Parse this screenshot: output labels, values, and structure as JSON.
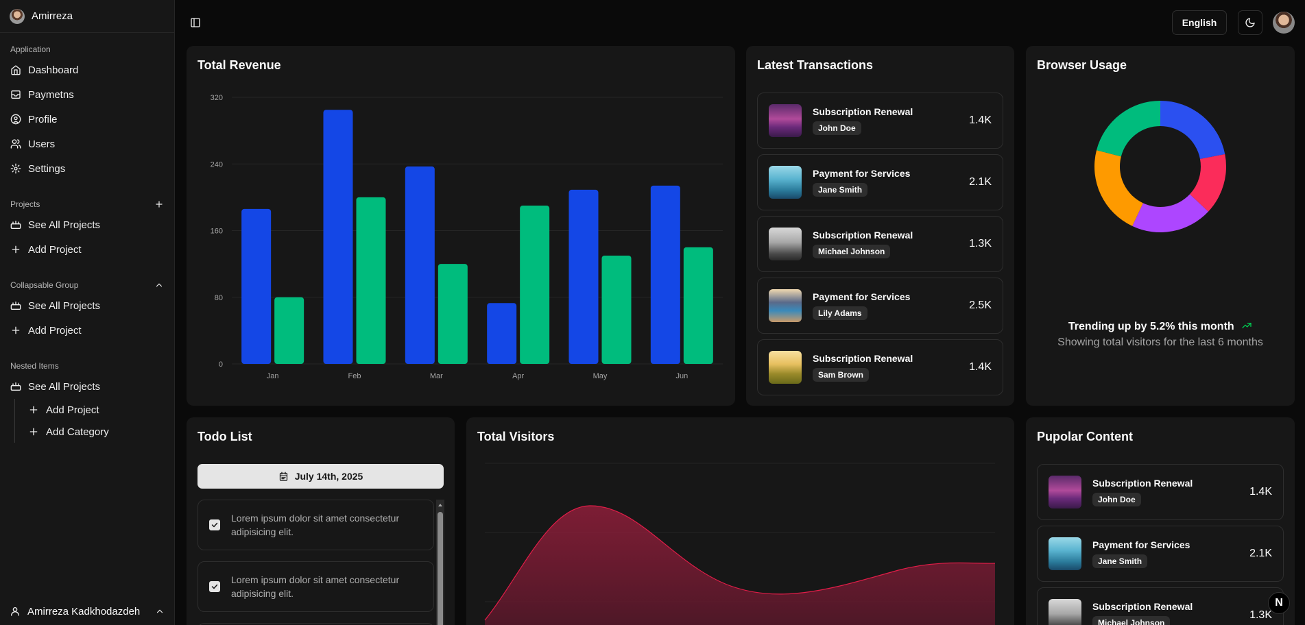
{
  "sidebar": {
    "user_name": "Amirreza",
    "group_application": "Application",
    "items": [
      {
        "label": "Dashboard",
        "icon": "home-icon"
      },
      {
        "label": "Paymetns",
        "icon": "inbox-icon"
      },
      {
        "label": "Profile",
        "icon": "user-circle-icon"
      },
      {
        "label": "Users",
        "icon": "users-icon"
      },
      {
        "label": "Settings",
        "icon": "gear-icon"
      }
    ],
    "group_projects": "Projects",
    "projects_items": [
      "See All Projects",
      "Add Project"
    ],
    "group_collapsable": "Collapsable Group",
    "collapsable_items": [
      "See All Projects",
      "Add Project"
    ],
    "group_nested": "Nested Items",
    "nested_top": "See All Projects",
    "nested_sub": [
      "Add Project",
      "Add Category"
    ],
    "footer_name": "Amirreza Kadkhodazdeh"
  },
  "topbar": {
    "language": "English"
  },
  "revenue": {
    "title": "Total Revenue"
  },
  "chart_data": {
    "type": "bar",
    "categories": [
      "Jan",
      "Feb",
      "Mar",
      "Apr",
      "May",
      "Jun"
    ],
    "series": [
      {
        "values": [
          186,
          305,
          237,
          73,
          209,
          214
        ],
        "color": "#1447e6"
      },
      {
        "values": [
          80,
          200,
          120,
          190,
          130,
          140
        ],
        "color": "#00bc7d"
      }
    ],
    "ylim": [
      0,
      320
    ],
    "yticks": [
      "0",
      "80",
      "160",
      "240",
      "320"
    ],
    "grid": true
  },
  "transactions": {
    "title": "Latest Transactions",
    "items": [
      {
        "title": "Subscription Renewal",
        "name": "John Doe",
        "amount": "1.4K",
        "thumb": "purple-landscape"
      },
      {
        "title": "Payment for Services",
        "name": "Jane Smith",
        "amount": "2.1K",
        "thumb": "blue-forest"
      },
      {
        "title": "Subscription Renewal",
        "name": "Michael Johnson",
        "amount": "1.3K",
        "thumb": "gray-forest"
      },
      {
        "title": "Payment for Services",
        "name": "Lily Adams",
        "amount": "2.5K",
        "thumb": "mountain-river"
      },
      {
        "title": "Subscription Renewal",
        "name": "Sam Brown",
        "amount": "1.4K",
        "thumb": "savanna"
      }
    ]
  },
  "browser": {
    "title": "Browser Usage",
    "trend": "Trending up by 5.2% this month",
    "subtitle": "Showing total visitors for the last 6 months",
    "donut": {
      "values": [
        22,
        15,
        20,
        22,
        21
      ],
      "colors": [
        "#2b50f0",
        "#fb2c5a",
        "#ad46ff",
        "#fe9a00",
        "#00bc7d"
      ]
    }
  },
  "todo": {
    "title": "Todo List",
    "date": "July 14th, 2025",
    "items": [
      {
        "text": "Lorem ipsum dolor sit amet consectetur adipisicing elit.",
        "checked": true
      },
      {
        "text": "Lorem ipsum dolor sit amet consectetur adipisicing elit.",
        "checked": true
      }
    ]
  },
  "visitors": {
    "title": "Total Visitors"
  },
  "popular": {
    "title": "Pupolar Content",
    "items": [
      {
        "title": "Subscription Renewal",
        "name": "John Doe",
        "amount": "1.4K",
        "thumb": "purple-landscape"
      },
      {
        "title": "Payment for Services",
        "name": "Jane Smith",
        "amount": "2.1K",
        "thumb": "blue-forest"
      },
      {
        "title": "Subscription Renewal",
        "name": "Michael Johnson",
        "amount": "1.3K",
        "thumb": "gray-forest"
      }
    ]
  },
  "badge": "N"
}
